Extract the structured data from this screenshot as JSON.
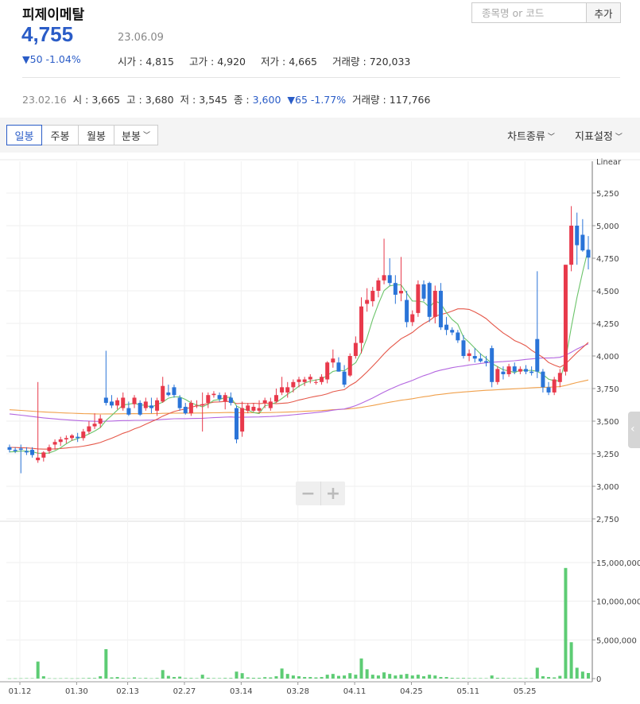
{
  "header": {
    "stock_name": "피제이메탈",
    "price": "4,755",
    "date": "23.06.09",
    "change": "▼50 -1.04%",
    "open_label": "시가",
    "open_value": "4,815",
    "high_label": "고가",
    "high_value": "4,920",
    "low_label": "저가",
    "low_value": "4,665",
    "volume_label": "거래량",
    "volume_value": "720,033"
  },
  "search": {
    "placeholder": "종목명 or 코드",
    "add_label": "추가"
  },
  "hover_info": {
    "date": "23.02.16",
    "open_label": "시",
    "open_value": "3,665",
    "high_label": "고",
    "high_value": "3,680",
    "low_label": "저",
    "low_value": "3,545",
    "close_label": "종",
    "close_value": "3,600",
    "change": "▼65 -1.77%",
    "volume_label": "거래량",
    "volume_value": "117,766"
  },
  "toolbar": {
    "tabs": [
      "일봉",
      "주봉",
      "월봉",
      "분봉"
    ],
    "active_tab": "일봉",
    "chart_type_label": "차트종류",
    "indicator_label": "지표설정"
  },
  "colors": {
    "up": "#e8394b",
    "down": "#2a74d8",
    "ma5": "#6cc46a",
    "ma20": "#e5584a",
    "ma60": "#b467e0",
    "ma120": "#f0a04b",
    "volume": "#5dcc74",
    "accent": "#2a5cc7"
  },
  "icons": {
    "minus": "minus-icon",
    "plus": "plus-icon",
    "side_handle": "chevron-left-icon",
    "dropdown": "chevron-down-icon"
  },
  "chart_data": {
    "type": "candlestick",
    "scale_label": "Linear",
    "price_axis": {
      "min": 2750,
      "max": 5250,
      "ticks": [
        "5,250",
        "5,000",
        "4,750",
        "4,500",
        "4,250",
        "4,000",
        "3,750",
        "3,500",
        "3,250",
        "3,000",
        "2,750"
      ]
    },
    "volume_axis": {
      "min": 0,
      "max": 15000000,
      "ticks": [
        "15,000,000",
        "10,000,000",
        "5,000,000",
        "0"
      ]
    },
    "x_ticks": [
      "01.12",
      "01.30",
      "02.13",
      "02.27",
      "03.14",
      "03.28",
      "04.11",
      "04.25",
      "05.11",
      "05.25"
    ],
    "moving_averages": [
      "MA5",
      "MA20",
      "MA60",
      "MA120"
    ],
    "candles": [
      [
        3300,
        3320,
        3260,
        3280
      ],
      [
        3280,
        3300,
        3255,
        3270
      ],
      [
        3290,
        3320,
        3100,
        3280
      ],
      [
        3270,
        3300,
        3240,
        3260
      ],
      [
        3280,
        3300,
        3220,
        3240
      ],
      [
        3200,
        3800,
        3180,
        3220
      ],
      [
        3220,
        3270,
        3190,
        3260
      ],
      [
        3270,
        3320,
        3250,
        3300
      ],
      [
        3320,
        3360,
        3280,
        3340
      ],
      [
        3340,
        3380,
        3310,
        3360
      ],
      [
        3360,
        3390,
        3330,
        3370
      ],
      [
        3370,
        3400,
        3350,
        3390
      ],
      [
        3380,
        3410,
        3340,
        3370
      ],
      [
        3370,
        3440,
        3350,
        3420
      ],
      [
        3420,
        3500,
        3400,
        3460
      ],
      [
        3460,
        3560,
        3440,
        3480
      ],
      [
        3480,
        3550,
        3450,
        3520
      ],
      [
        3680,
        4040,
        3620,
        3640
      ],
      [
        3650,
        3700,
        3600,
        3620
      ],
      [
        3620,
        3680,
        3590,
        3660
      ],
      [
        3600,
        3720,
        3580,
        3680
      ],
      [
        3600,
        3650,
        3540,
        3550
      ],
      [
        3630,
        3700,
        3600,
        3680
      ],
      [
        3640,
        3660,
        3540,
        3550
      ],
      [
        3600,
        3680,
        3580,
        3650
      ],
      [
        3620,
        3680,
        3560,
        3600
      ],
      [
        3580,
        3680,
        3540,
        3660
      ],
      [
        3650,
        3840,
        3640,
        3770
      ],
      [
        3720,
        3780,
        3690,
        3700
      ],
      [
        3760,
        3780,
        3680,
        3700
      ],
      [
        3680,
        3700,
        3580,
        3600
      ],
      [
        3610,
        3640,
        3550,
        3560
      ],
      [
        3560,
        3660,
        3540,
        3640
      ],
      [
        3620,
        3660,
        3600,
        3620
      ],
      [
        3620,
        3720,
        3420,
        3630
      ],
      [
        3640,
        3720,
        3600,
        3700
      ],
      [
        3700,
        3730,
        3680,
        3710
      ],
      [
        3700,
        3720,
        3650,
        3670
      ],
      [
        3650,
        3720,
        3590,
        3700
      ],
      [
        3680,
        3720,
        3620,
        3640
      ],
      [
        3600,
        3620,
        3330,
        3360
      ],
      [
        3420,
        3650,
        3380,
        3600
      ],
      [
        3580,
        3640,
        3560,
        3620
      ],
      [
        3580,
        3640,
        3570,
        3610
      ],
      [
        3580,
        3660,
        3560,
        3600
      ],
      [
        3640,
        3680,
        3600,
        3660
      ],
      [
        3600,
        3680,
        3580,
        3650
      ],
      [
        3650,
        3750,
        3640,
        3700
      ],
      [
        3720,
        3840,
        3700,
        3760
      ],
      [
        3720,
        3800,
        3680,
        3760
      ],
      [
        3760,
        3820,
        3720,
        3800
      ],
      [
        3800,
        3840,
        3760,
        3820
      ],
      [
        3800,
        3840,
        3770,
        3820
      ],
      [
        3820,
        3860,
        3790,
        3840
      ],
      [
        3800,
        3820,
        3780,
        3800
      ],
      [
        3800,
        3860,
        3780,
        3840
      ],
      [
        3820,
        3960,
        3790,
        3950
      ],
      [
        3950,
        4050,
        3910,
        3980
      ],
      [
        3950,
        3990,
        3880,
        3880
      ],
      [
        3880,
        3930,
        3760,
        3780
      ],
      [
        3850,
        4020,
        3840,
        4000
      ],
      [
        4000,
        4150,
        3980,
        4100
      ],
      [
        4100,
        4450,
        4020,
        4380
      ],
      [
        4400,
        4520,
        4340,
        4430
      ],
      [
        4420,
        4530,
        4380,
        4500
      ],
      [
        4500,
        4600,
        4450,
        4580
      ],
      [
        4580,
        4900,
        4550,
        4620
      ],
      [
        4620,
        4750,
        4540,
        4560
      ],
      [
        4560,
        4620,
        4400,
        4470
      ],
      [
        4480,
        4760,
        4420,
        4500
      ],
      [
        4430,
        4500,
        4220,
        4260
      ],
      [
        4260,
        4350,
        4230,
        4320
      ],
      [
        4330,
        4580,
        4300,
        4550
      ],
      [
        4550,
        4580,
        4420,
        4440
      ],
      [
        4560,
        4570,
        4260,
        4300
      ],
      [
        4300,
        4540,
        4250,
        4500
      ],
      [
        4500,
        4560,
        4200,
        4220
      ],
      [
        4240,
        4300,
        4160,
        4200
      ],
      [
        4200,
        4220,
        4160,
        4180
      ],
      [
        4180,
        4200,
        4100,
        4120
      ],
      [
        4120,
        4160,
        3980,
        4000
      ],
      [
        4000,
        4050,
        3960,
        4020
      ],
      [
        4000,
        4060,
        3950,
        3980
      ],
      [
        3980,
        4020,
        3950,
        3960
      ],
      [
        3960,
        4000,
        3920,
        3950
      ],
      [
        4060,
        4080,
        3760,
        3800
      ],
      [
        3800,
        3920,
        3780,
        3900
      ],
      [
        3880,
        3920,
        3820,
        3860
      ],
      [
        3860,
        3940,
        3840,
        3920
      ],
      [
        3920,
        3950,
        3860,
        3880
      ],
      [
        3880,
        3920,
        3860,
        3900
      ],
      [
        3900,
        3930,
        3860,
        3880
      ],
      [
        3880,
        3920,
        3850,
        3870
      ],
      [
        4130,
        4650,
        3830,
        3880
      ],
      [
        3880,
        3900,
        3720,
        3760
      ],
      [
        3760,
        3800,
        3700,
        3720
      ],
      [
        3720,
        3840,
        3700,
        3820
      ],
      [
        3800,
        3900,
        3760,
        3870
      ],
      [
        3880,
        4700,
        3850,
        4700
      ],
      [
        4700,
        5150,
        4650,
        5000
      ],
      [
        5000,
        5100,
        4700,
        4850
      ],
      [
        4930,
        5050,
        4800,
        4810
      ],
      [
        4815,
        4920,
        4665,
        4755
      ]
    ],
    "volume": [
      20000,
      30000,
      40000,
      50000,
      50000,
      2200000,
      300000,
      40000,
      30000,
      40000,
      50000,
      30000,
      40000,
      60000,
      80000,
      80000,
      300000,
      3800000,
      150000,
      200000,
      80000,
      60000,
      150000,
      60000,
      80000,
      40000,
      70000,
      1100000,
      350000,
      200000,
      250000,
      80000,
      80000,
      60000,
      500000,
      100000,
      60000,
      60000,
      80000,
      80000,
      900000,
      700000,
      150000,
      100000,
      100000,
      180000,
      150000,
      300000,
      1300000,
      600000,
      400000,
      300000,
      200000,
      200000,
      150000,
      200000,
      500000,
      600000,
      350000,
      400000,
      700000,
      500000,
      2600000,
      1200000,
      500000,
      400000,
      800000,
      600000,
      400000,
      500000,
      600000,
      400000,
      500000,
      300000,
      500000,
      400000,
      200000,
      200000,
      100000,
      80000,
      80000,
      60000,
      60000,
      60000,
      50000,
      400000,
      100000,
      80000,
      60000,
      60000,
      60000,
      60000,
      60000,
      1400000,
      300000,
      200000,
      150000,
      350000,
      14300000,
      4700000,
      1400000,
      900000,
      720033
    ]
  }
}
